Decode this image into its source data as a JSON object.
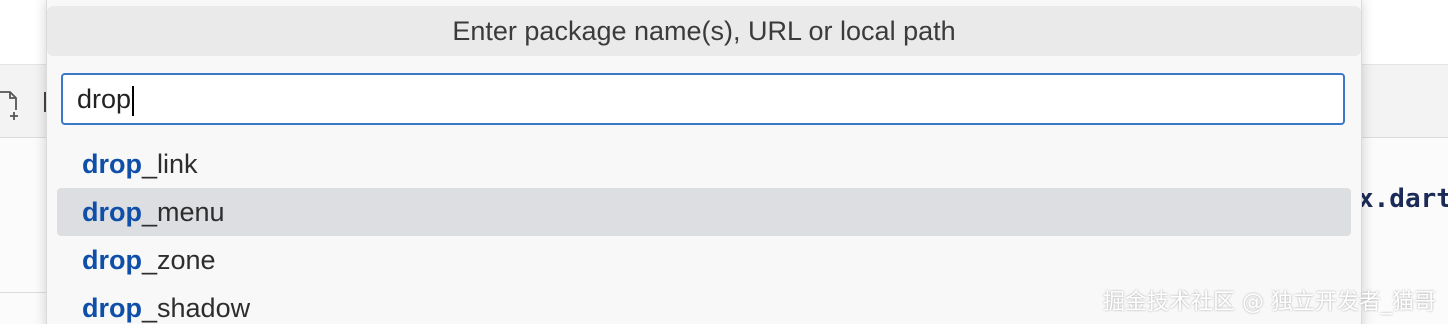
{
  "quick_pick": {
    "title": "Enter package name(s), URL or local path",
    "input": {
      "value": "drop"
    },
    "items": [
      {
        "match": "drop",
        "rest": "_link",
        "selected": false
      },
      {
        "match": "drop",
        "rest": "_menu",
        "selected": true
      },
      {
        "match": "drop",
        "rest": "_zone",
        "selected": false
      },
      {
        "match": "drop",
        "rest": "_shadow",
        "selected": false
      }
    ]
  },
  "background": {
    "editor_snippet": "x.dart"
  },
  "watermark": "掘金技术社区 @ 独立开发者_猫哥",
  "colors": {
    "accent_border": "#3c78c8",
    "match_highlight": "#0f4fa8",
    "selection_bg": "#dcdee2"
  }
}
